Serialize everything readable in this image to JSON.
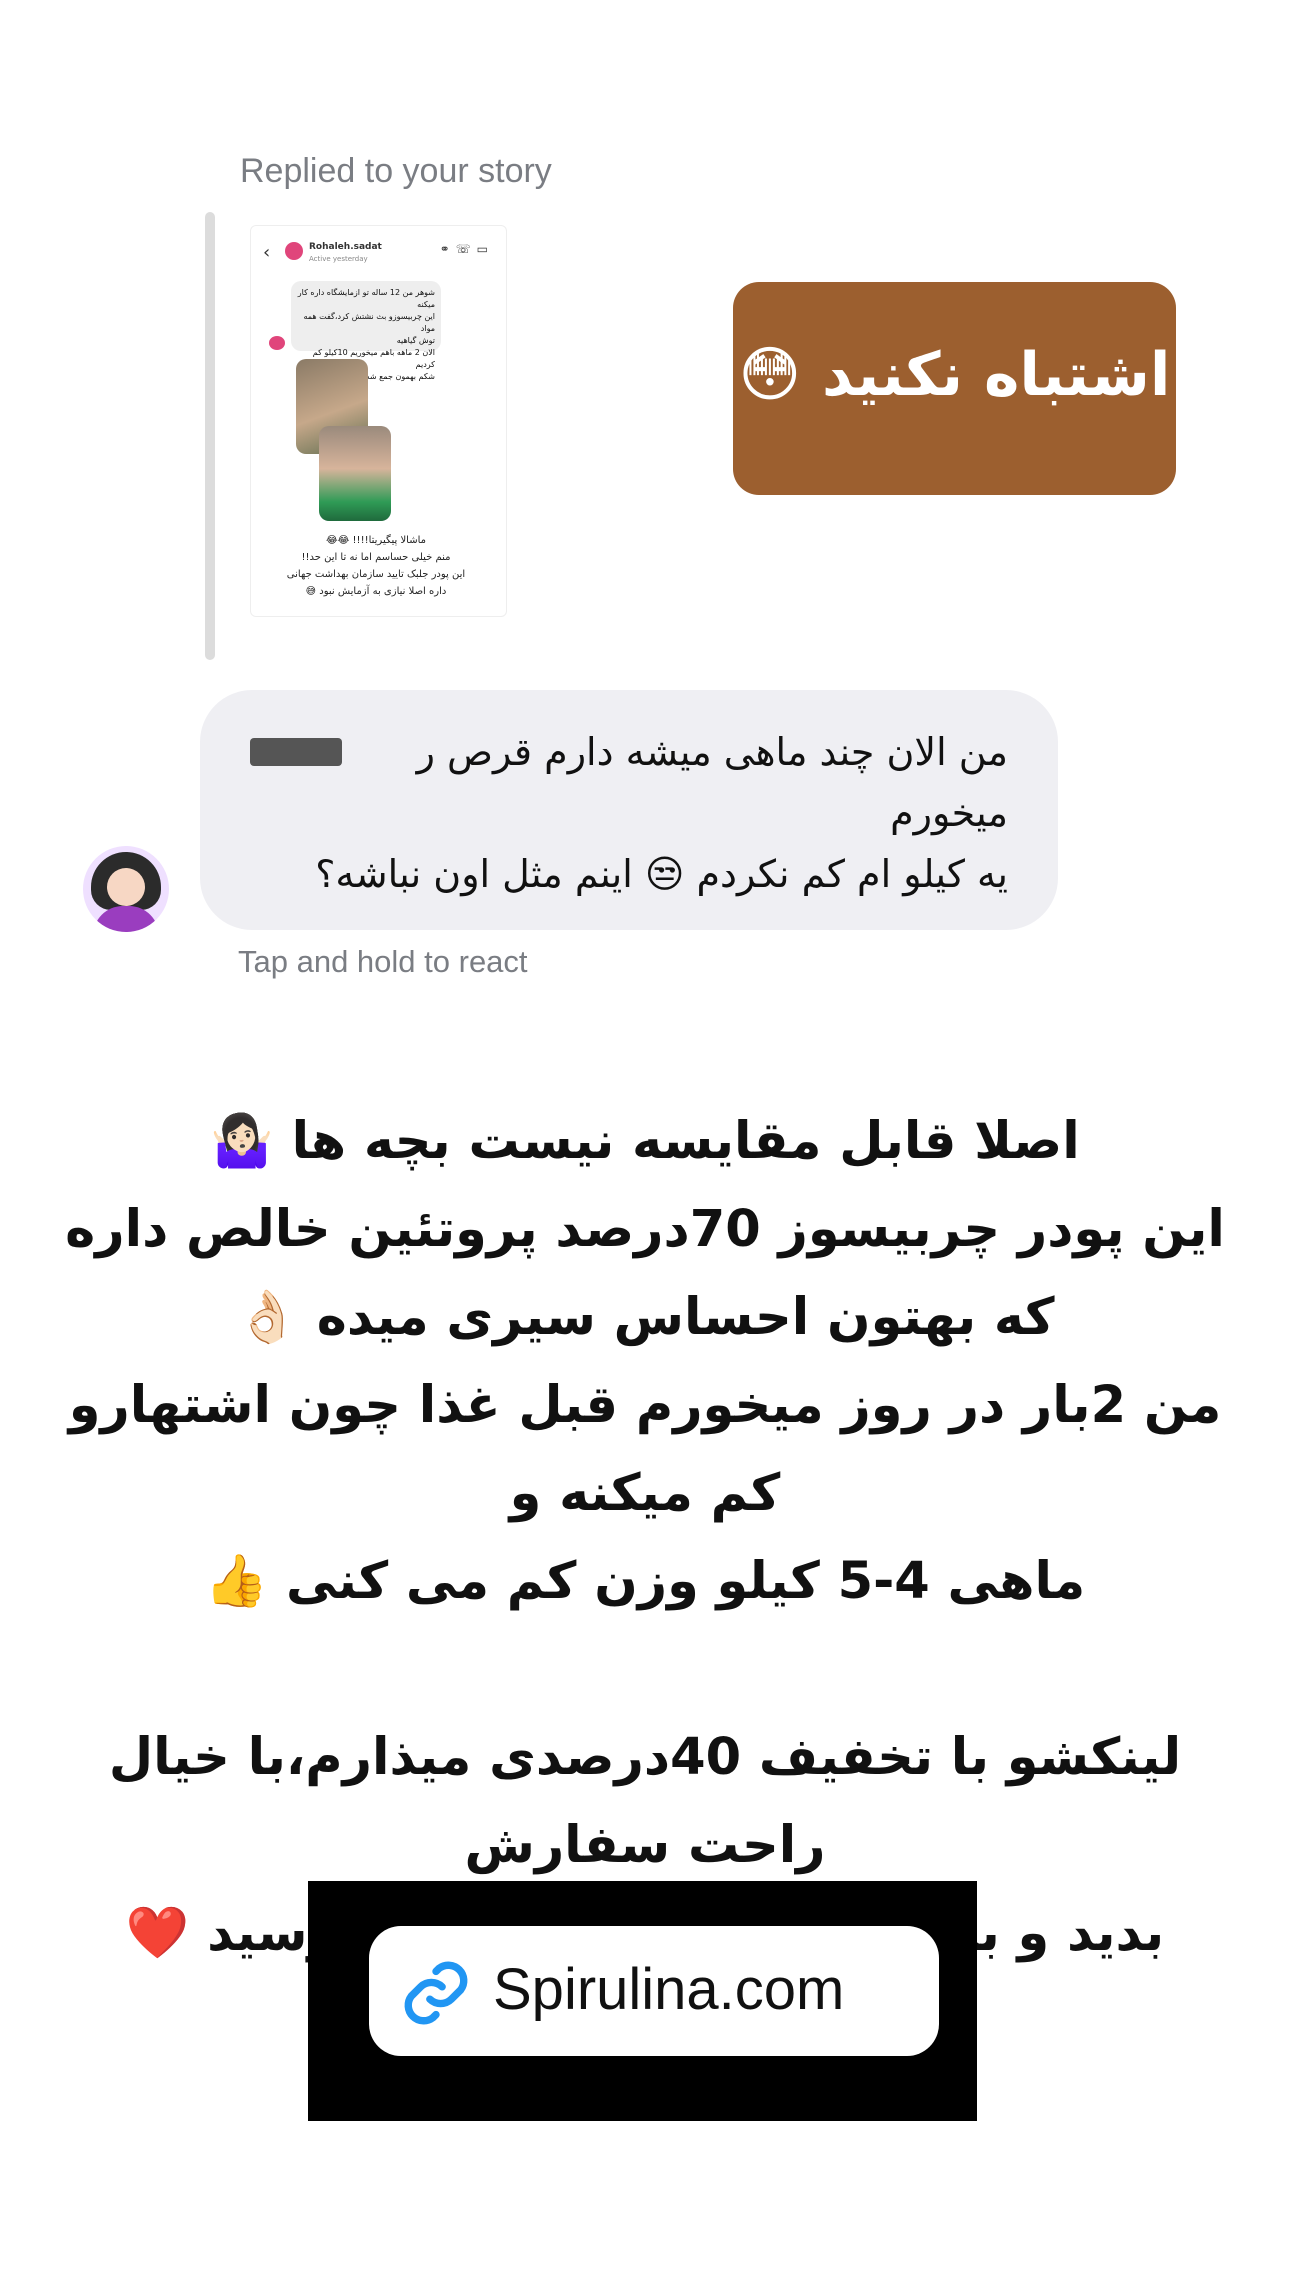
{
  "reply_header": "Replied to your story",
  "story_thumbnail": {
    "username": "Rohaleh.sadat",
    "status": "Active yesterday",
    "message_lines": [
      "شوهر من 12 ساله تو ازمایشگاه داره کار میکنه",
      "این چربیسوزو بث نشتش کرد،گفت همه مواد",
      "توش گیاهیه",
      "الان 2 ماهه باهم میخوریم 10کیلو کم کردیم",
      "شکم بهمون جمع شده"
    ],
    "reply_lines": [
      "ماشالا پیگیریتا!!!! 😂😂",
      "منم خیلی حساسم اما نه تا این حد!!",
      "این پودر جلبک تایید سازمان بهداشت جهانی",
      "داره اصلا نیازی به آزمایش نبود 😅"
    ]
  },
  "sticker_text": "اشتباه نکنید 😳",
  "message": {
    "line1": "من الان چند ماهی میشه دارم قرص ر",
    "line2": "میخورم",
    "line3": "یه کیلو ام کم نکردم 😒 اینم مثل اون نباشه؟"
  },
  "react_hint": "Tap and hold to react",
  "promo_text": {
    "line1": "اصلا قابل مقایسه نیست بچه ها 🤷🏻‍♀️",
    "line2": "این پودر چربیسوز 70درصد پروتئین خالص داره",
    "line3": "که بهتون احساس سیری میده 👌🏻",
    "line4": "من 2بار در روز میخورم قبل غذا چون اشتهارو کم میکنه و",
    "line5": "ماهی 4-5 کیلو وزن کم می کنی 👍",
    "line6": "لینکشو با تخفیف 40درصدی میذارم،با خیال راحت سفارش",
    "line7": "بدید و به هیکلی که دوست دارید برسید ❤️"
  },
  "link": {
    "icon": "link-icon",
    "label": "Spirulina.com",
    "icon_color": "#2196f3"
  },
  "colors": {
    "sticker_bg": "#9c5f2f",
    "bubble_bg": "#efeff3",
    "muted_text": "#7a7d83"
  }
}
